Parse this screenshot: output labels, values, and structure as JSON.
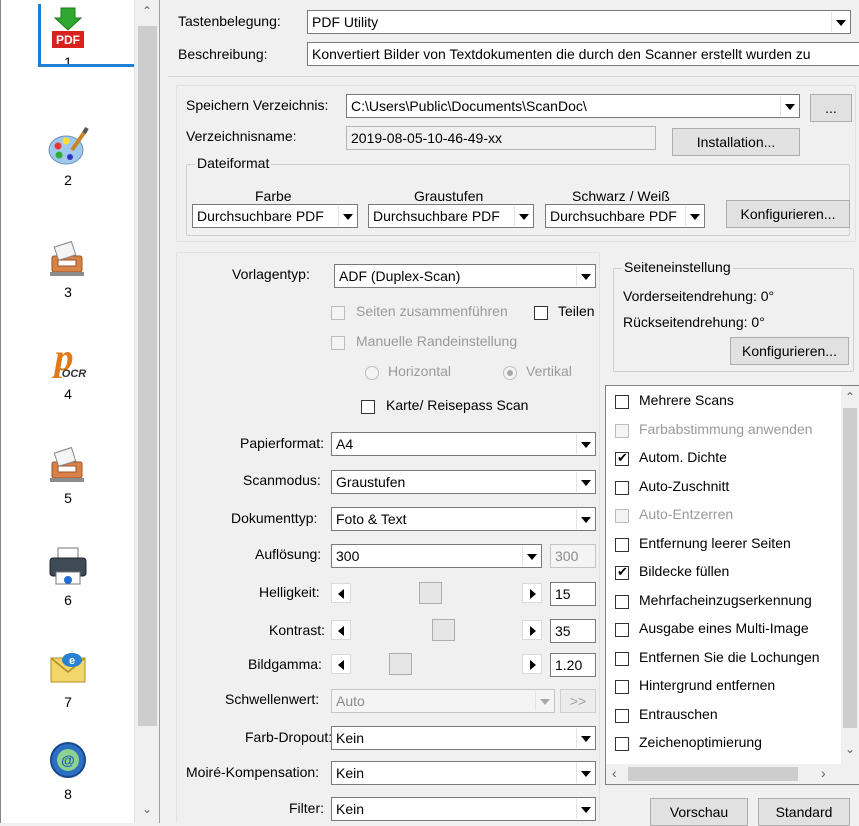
{
  "sidebar": {
    "items": [
      {
        "num": "1",
        "icon": "pdf-icon",
        "selected": true
      },
      {
        "num": "2",
        "icon": "palette-icon"
      },
      {
        "num": "3",
        "icon": "scanner-icon"
      },
      {
        "num": "4",
        "icon": "ocr-icon",
        "icon_text": "OCR"
      },
      {
        "num": "5",
        "icon": "scanner-icon"
      },
      {
        "num": "6",
        "icon": "printer-icon"
      },
      {
        "num": "7",
        "icon": "email-icon"
      },
      {
        "num": "8",
        "icon": "globe-icon"
      }
    ],
    "pdf_badge": "PDF"
  },
  "header": {
    "tastenbelegung_label": "Tastenbelegung:",
    "tastenbelegung_value": "PDF Utility",
    "beschreibung_label": "Beschreibung:",
    "beschreibung_value": "Konvertiert Bilder von Textdokumenten die durch den Scanner erstellt wurden  zu"
  },
  "save": {
    "dir_label": "Speichern Verzeichnis:",
    "dir_value": "C:\\Users\\Public\\Documents\\ScanDoc\\",
    "browse_label": "...",
    "name_label": "Verzeichnisname:",
    "name_value": "2019-08-05-10-46-49-xx",
    "install_label": "Installation..."
  },
  "fileformat": {
    "group_title": "Dateiformat",
    "farbe_label": "Farbe",
    "graustufen_label": "Graustufen",
    "sw_label": "Schwarz / Weiß",
    "farbe_value": "Durchsuchbare PDF",
    "graustufen_value": "Durchsuchbare PDF",
    "sw_value": "Durchsuchbare PDF",
    "config_label": "Konfigurieren..."
  },
  "scan": {
    "vorlagentyp_label": "Vorlagentyp:",
    "vorlagentyp_value": "ADF (Duplex-Scan)",
    "merge_label": "Seiten zusammenführen",
    "split_label": "Teilen",
    "manual_margin_label": "Manuelle Randeinstellung",
    "horizontal_label": "Horizontal",
    "vertical_label": "Vertikal",
    "card_label": "Karte/ Reisepass Scan",
    "paper_label": "Papierformat:",
    "paper_value": "A4",
    "mode_label": "Scanmodus:",
    "mode_value": "Graustufen",
    "doctype_label": "Dokumenttyp:",
    "doctype_value": "Foto & Text",
    "resolution_label": "Auflösung:",
    "resolution_value": "300",
    "resolution_box": "300",
    "brightness_label": "Helligkeit:",
    "brightness_value": "15",
    "contrast_label": "Kontrast:",
    "contrast_value": "35",
    "gamma_label": "Bildgamma:",
    "gamma_value": "1.20",
    "threshold_label": "Schwellenwert:",
    "threshold_value": "Auto",
    "threshold_btn": ">>",
    "dropout_label": "Farb-Dropout:",
    "dropout_value": "Kein",
    "moire_label": "Moiré-Kompensation:",
    "moire_value": "Kein",
    "filter_label": "Filter:",
    "filter_value": "Kein"
  },
  "page_settings": {
    "group_title": "Seiteneinstellung",
    "front_rotation": "Vorderseitendrehung: 0°",
    "back_rotation": "Rückseitendrehung: 0°",
    "config_label": "Konfigurieren..."
  },
  "options": [
    {
      "label": "Mehrere Scans",
      "checked": false,
      "disabled": false
    },
    {
      "label": "Farbabstimmung anwenden",
      "checked": false,
      "disabled": true
    },
    {
      "label": "Autom. Dichte",
      "checked": true,
      "disabled": false
    },
    {
      "label": "Auto-Zuschnitt",
      "checked": false,
      "disabled": false
    },
    {
      "label": "Auto-Entzerren",
      "checked": false,
      "disabled": true
    },
    {
      "label": "Entfernung leerer Seiten",
      "checked": false,
      "disabled": false
    },
    {
      "label": "Bildecke füllen",
      "checked": true,
      "disabled": false
    },
    {
      "label": "Mehrfacheinzugserkennung",
      "checked": false,
      "disabled": false
    },
    {
      "label": "Ausgabe eines Multi-Image",
      "checked": false,
      "disabled": false
    },
    {
      "label": "Entfernen Sie die Lochungen",
      "checked": false,
      "disabled": false
    },
    {
      "label": "Hintergrund entfernen",
      "checked": false,
      "disabled": false
    },
    {
      "label": "Entrauschen",
      "checked": false,
      "disabled": false
    },
    {
      "label": "Zeichenoptimierung",
      "checked": false,
      "disabled": false
    }
  ],
  "footer": {
    "preview_label": "Vorschau",
    "default_label": "Standard"
  },
  "sliders": {
    "brightness_fraction": 0.46,
    "contrast_fraction": 0.55,
    "gamma_fraction": 0.25
  },
  "colors": {
    "selection_border": "#1e7fd6",
    "pdf_red": "#d9221c",
    "arrow_green": "#2fa82f"
  }
}
